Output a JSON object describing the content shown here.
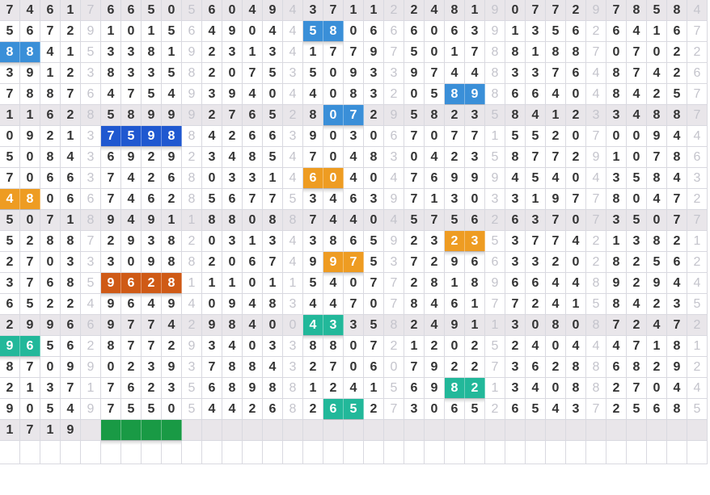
{
  "colors": {
    "band": "#e9e6ea",
    "blue": "#3a8fd8",
    "navy": "#1f58d0",
    "orange": "#ee9c22",
    "rust": "#cf5a16",
    "teal": "#22b89a",
    "green": "#199a45"
  },
  "band_rows": [
    0,
    5,
    10,
    15,
    20
  ],
  "rows": [
    "74617665056049437112248190772978584",
    "56729101564904458066606391356264167",
    "88415338192313417797501788188707022",
    "39123833582075350933974483376487426",
    "78876475493940440832058986640484257",
    "11628589992765280729582358412334887",
    "09213759884266390306707715520700944",
    "50843692923485470483042358772910786",
    "70663742680331460404769994540435843",
    "48066746285677534639713033197780472",
    "50718949118808874404575626370735077",
    "52887293820313438659232353774213821",
    "27033309882067499753729663320282562",
    "37685962811101154077281896644892944",
    "65224964940948344707846177241584235",
    "29966977429840043358249113080872472",
    "96562877293403388072120252404447181",
    "87099023937884327060792273628868292",
    "21371762356898812415698213408827044",
    "90549755054426826527306526543725685",
    "1719#####..........................",
    ""
  ],
  "highlights": [
    {
      "row": 1,
      "cols": [
        15,
        16
      ],
      "color": "blue"
    },
    {
      "row": 2,
      "cols": [
        0,
        1
      ],
      "color": "blue"
    },
    {
      "row": 4,
      "cols": [
        22,
        23
      ],
      "color": "blue"
    },
    {
      "row": 5,
      "cols": [
        16,
        17
      ],
      "color": "blue"
    },
    {
      "row": 6,
      "cols": [
        5,
        6,
        7,
        8
      ],
      "color": "navy"
    },
    {
      "row": 8,
      "cols": [
        15,
        16
      ],
      "color": "orange"
    },
    {
      "row": 9,
      "cols": [
        0,
        1
      ],
      "color": "orange"
    },
    {
      "row": 11,
      "cols": [
        22,
        23
      ],
      "color": "orange"
    },
    {
      "row": 12,
      "cols": [
        16,
        17
      ],
      "color": "orange"
    },
    {
      "row": 13,
      "cols": [
        5,
        6,
        7,
        8
      ],
      "color": "rust"
    },
    {
      "row": 15,
      "cols": [
        15,
        16
      ],
      "color": "teal"
    },
    {
      "row": 16,
      "cols": [
        0,
        1
      ],
      "color": "teal"
    },
    {
      "row": 18,
      "cols": [
        22,
        23
      ],
      "color": "teal"
    },
    {
      "row": 19,
      "cols": [
        16,
        17
      ],
      "color": "teal"
    },
    {
      "row": 20,
      "cols": [
        5,
        6,
        7,
        8
      ],
      "color": "green"
    }
  ]
}
